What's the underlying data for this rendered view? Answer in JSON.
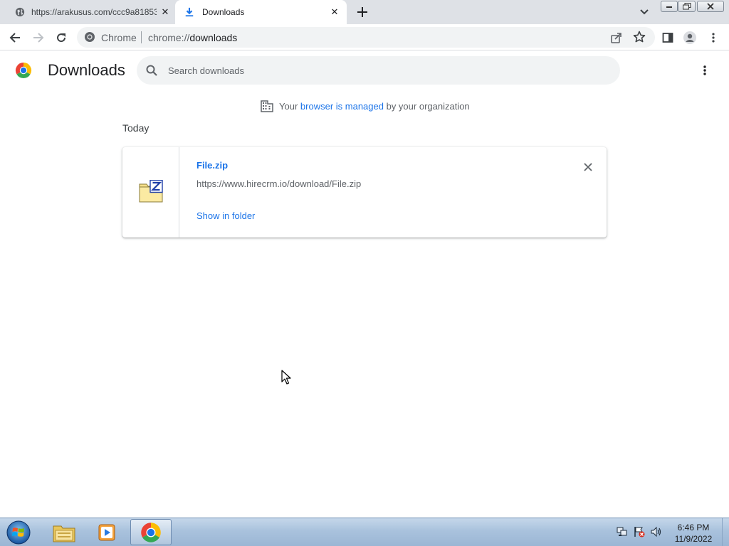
{
  "tabs": [
    {
      "title": "https://arakusus.com/ccc9a81853",
      "active": false
    },
    {
      "title": "Downloads",
      "active": true
    }
  ],
  "toolbar": {
    "site_label": "Chrome",
    "url_scheme": "chrome://",
    "url_host": "downloads"
  },
  "page": {
    "title": "Downloads",
    "search_placeholder": "Search downloads"
  },
  "managed_notice": {
    "prefix": "Your",
    "link": "browser is managed",
    "suffix": "by your organization"
  },
  "section_date": "Today",
  "downloads": [
    {
      "filename": "File.zip",
      "url": "https://www.hirecrm.io/download/File.zip",
      "action": "Show in folder",
      "file_type_icon": "zip-file-icon"
    }
  ],
  "taskbar": {
    "items": [
      "windows-explorer",
      "media-player",
      "google-chrome"
    ],
    "clock_time": "6:46 PM",
    "clock_date": "11/9/2022"
  },
  "colors": {
    "link_blue": "#1a73e8",
    "tabstrip_bg": "#dee1e6",
    "omnibox_bg": "#f1f3f4"
  }
}
